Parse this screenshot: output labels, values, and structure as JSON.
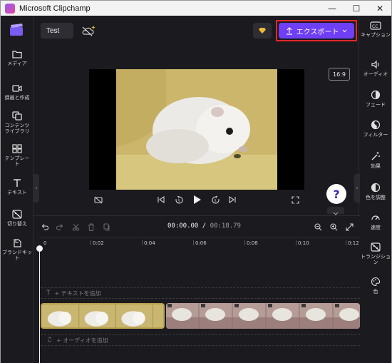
{
  "window": {
    "title": "Microsoft Clipchamp",
    "minimize": "—",
    "maximize": "☐",
    "close": "✕"
  },
  "left_nav": [
    {
      "label": "メディア",
      "icon": "folder-icon"
    },
    {
      "label": "録画と作成",
      "icon": "camera-icon"
    },
    {
      "label": "コンテンツライブラリ",
      "icon": "content-library-icon"
    },
    {
      "label": "テンプレート",
      "icon": "template-icon"
    },
    {
      "label": "テキスト",
      "icon": "text-icon"
    },
    {
      "label": "切り替え",
      "icon": "transition-icon"
    },
    {
      "label": "ブランドキット",
      "icon": "brand-kit-icon"
    }
  ],
  "right_nav": [
    {
      "label": "キャプション",
      "icon": "captions-icon"
    },
    {
      "label": "オーディオ",
      "icon": "speaker-icon"
    },
    {
      "label": "フェード",
      "icon": "fade-icon"
    },
    {
      "label": "フィルター",
      "icon": "filter-icon"
    },
    {
      "label": "効果",
      "icon": "magic-wand-icon"
    },
    {
      "label": "色を調整",
      "icon": "adjust-color-icon"
    },
    {
      "label": "速度",
      "icon": "speed-icon"
    },
    {
      "label": "トランジション",
      "icon": "transition-icon"
    },
    {
      "label": "色",
      "icon": "palette-icon"
    }
  ],
  "topbar": {
    "project_name": "Test",
    "export_label": "エクスポート"
  },
  "preview": {
    "aspect_ratio": "16:9",
    "help": "?"
  },
  "timeline": {
    "current_time": "00:00.00",
    "separator": " / ",
    "total_time": "00:18.79",
    "ticks": [
      "0",
      "0:02",
      "0:04",
      "0:06",
      "0:08",
      "0:10",
      "0:12"
    ],
    "text_track_label": "+ テキストを追加",
    "audio_track_label": "+ オーディオを追加"
  },
  "colors": {
    "accent": "#6f3ff5",
    "highlight": "#e5262b"
  }
}
